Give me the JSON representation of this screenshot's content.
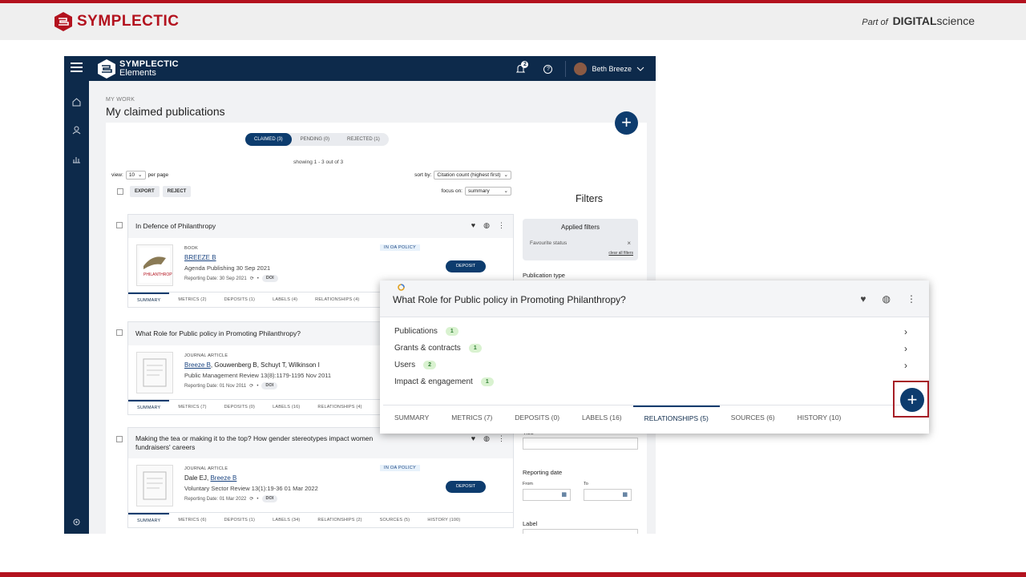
{
  "banner": {
    "brand": "SYMPLECTIC",
    "part_of": "Part of",
    "digital": "DIGITAL",
    "science": "science"
  },
  "app": {
    "logo_line1": "SYMPLECTIC",
    "logo_line2": "Elements",
    "notification_count": "2",
    "user_name": "Beth Breeze"
  },
  "page": {
    "breadcrumb": "MY WORK",
    "title": "My claimed publications",
    "tabs": [
      "CLAIMED (3)",
      "PENDING (0)",
      "REJECTED (1)"
    ],
    "showing": "showing 1 - 3 out of 3",
    "view_label": "view:",
    "view_value": "10",
    "per_page": "per page",
    "sort_label": "sort by:",
    "sort_value": "Citation count (highest first)",
    "focus_label": "focus on:",
    "focus_value": "summary",
    "export": "EXPORT",
    "reject": "REJECT"
  },
  "publications": [
    {
      "title": "In Defence of Philanthropy",
      "type": "BOOK",
      "authors_link": "BREEZE B",
      "authors_rest": "",
      "venue": "Agenda Publishing 30 Sep 2021",
      "reporting": "Reporting Date: 30 Sep 2021",
      "doi": "DOI",
      "oa": "IN OA POLICY",
      "deposit": "DEPOSIT",
      "tabs": [
        "SUMMARY",
        "METRICS (2)",
        "DEPOSITS (1)",
        "LABELS (4)",
        "RELATIONSHIPS (4)"
      ]
    },
    {
      "title": "What Role for Public policy in Promoting Philanthropy?",
      "type": "JOURNAL ARTICLE",
      "authors_link": "Breeze B",
      "authors_rest": ", Gouwenberg B, Schuyt T, Wilkinson I",
      "venue": "Public Management Review 13(8):1179-1195 Nov 2011",
      "reporting": "Reporting Date: 01 Nov 2011",
      "doi": "DOI",
      "oa": "",
      "deposit": "",
      "tabs": [
        "SUMMARY",
        "METRICS (7)",
        "DEPOSITS (0)",
        "LABELS (16)",
        "RELATIONSHIPS (4)"
      ]
    },
    {
      "title": "Making the tea or making it to the top? How gender stereotypes impact women fundraisers' careers",
      "type": "JOURNAL ARTICLE",
      "authors_prefix": "Dale EJ, ",
      "authors_link": "Breeze B",
      "authors_rest": "",
      "venue": "Voluntary Sector Review 13(1):19-36 01 Mar 2022",
      "reporting": "Reporting Date: 01 Mar 2022",
      "doi": "DOI",
      "oa": "IN OA POLICY",
      "deposit": "DEPOSIT",
      "tabs": [
        "SUMMARY",
        "METRICS (6)",
        "DEPOSITS (1)",
        "LABELS (34)",
        "RELATIONSHIPS (2)",
        "SOURCES (5)",
        "HISTORY (100)"
      ]
    }
  ],
  "filters": {
    "title": "Filters",
    "applied": "Applied filters",
    "favourite": "Favourite status",
    "clear": "clear all filters",
    "publication_type": "Publication type",
    "title_label": "Title",
    "reporting_date": "Reporting date",
    "from": "From",
    "to": "To",
    "label": "Label"
  },
  "zoom": {
    "title": "What Role for Public policy in Promoting Philanthropy?",
    "relationships": [
      {
        "label": "Publications",
        "count": "1"
      },
      {
        "label": "Grants & contracts",
        "count": "1"
      },
      {
        "label": "Users",
        "count": "2"
      },
      {
        "label": "Impact & engagement",
        "count": "1"
      }
    ],
    "tabs": [
      "SUMMARY",
      "METRICS (7)",
      "DEPOSITS (0)",
      "LABELS (16)",
      "RELATIONSHIPS (5)",
      "SOURCES (6)",
      "HISTORY (10)"
    ],
    "active_tab": 4
  },
  "colors": {
    "brand_red": "#b3121e",
    "navy": "#0d2a4b",
    "button_blue": "#0d3c6e"
  }
}
